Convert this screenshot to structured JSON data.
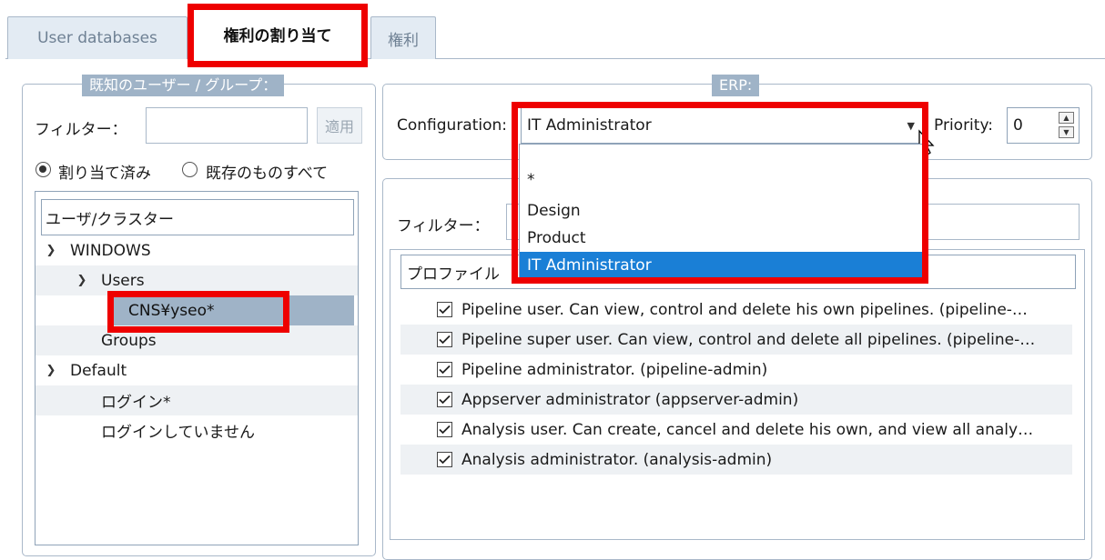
{
  "tabs": [
    {
      "label": "User databases",
      "active": false
    },
    {
      "label": "権利の割り当て",
      "active": true
    },
    {
      "label": "権利",
      "active": false
    }
  ],
  "known_users": {
    "legend": "既知のユーザー / グループ：",
    "filter_label": "フィルター：",
    "filter_value": "",
    "apply_label": "適用",
    "radio_assigned": "割り当て済み",
    "radio_all": "既存のものすべて",
    "tree_header": "ユーザ/クラスター",
    "tree": {
      "windows": "WINDOWS",
      "users": "Users",
      "selected_user": "CNS¥yseo*",
      "groups": "Groups",
      "default": "Default",
      "login": "ログイン*",
      "not_logged_in": "ログインしていません"
    }
  },
  "erp": {
    "legend": "ERP:",
    "configuration_label": "Configuration:",
    "configuration_value": "IT Administrator",
    "priority_label": "Priority:",
    "priority_value": "0",
    "options": [
      "*",
      "Design",
      "Product",
      "IT Administrator"
    ]
  },
  "profiles": {
    "filter_label": "フィルター：",
    "header": "プロファイル",
    "items": [
      {
        "label": "Pipeline user. Can view, control and delete his own pipelines. (pipeline-…",
        "checked": true
      },
      {
        "label": "Pipeline super user. Can view, control and delete all pipelines. (pipeline-…",
        "checked": true
      },
      {
        "label": "Pipeline administrator. (pipeline-admin)",
        "checked": true
      },
      {
        "label": "Appserver administrator (appserver-admin)",
        "checked": true
      },
      {
        "label": "Analysis user. Can create, cancel and delete his own, and view all analy…",
        "checked": true
      },
      {
        "label": "Analysis administrator. (analysis-admin)",
        "checked": true
      }
    ]
  },
  "colors": {
    "highlight": "#ee0000",
    "selection": "#1a7fd6",
    "legend_bg": "#9fb3c7",
    "border": "#a9b8c9"
  }
}
